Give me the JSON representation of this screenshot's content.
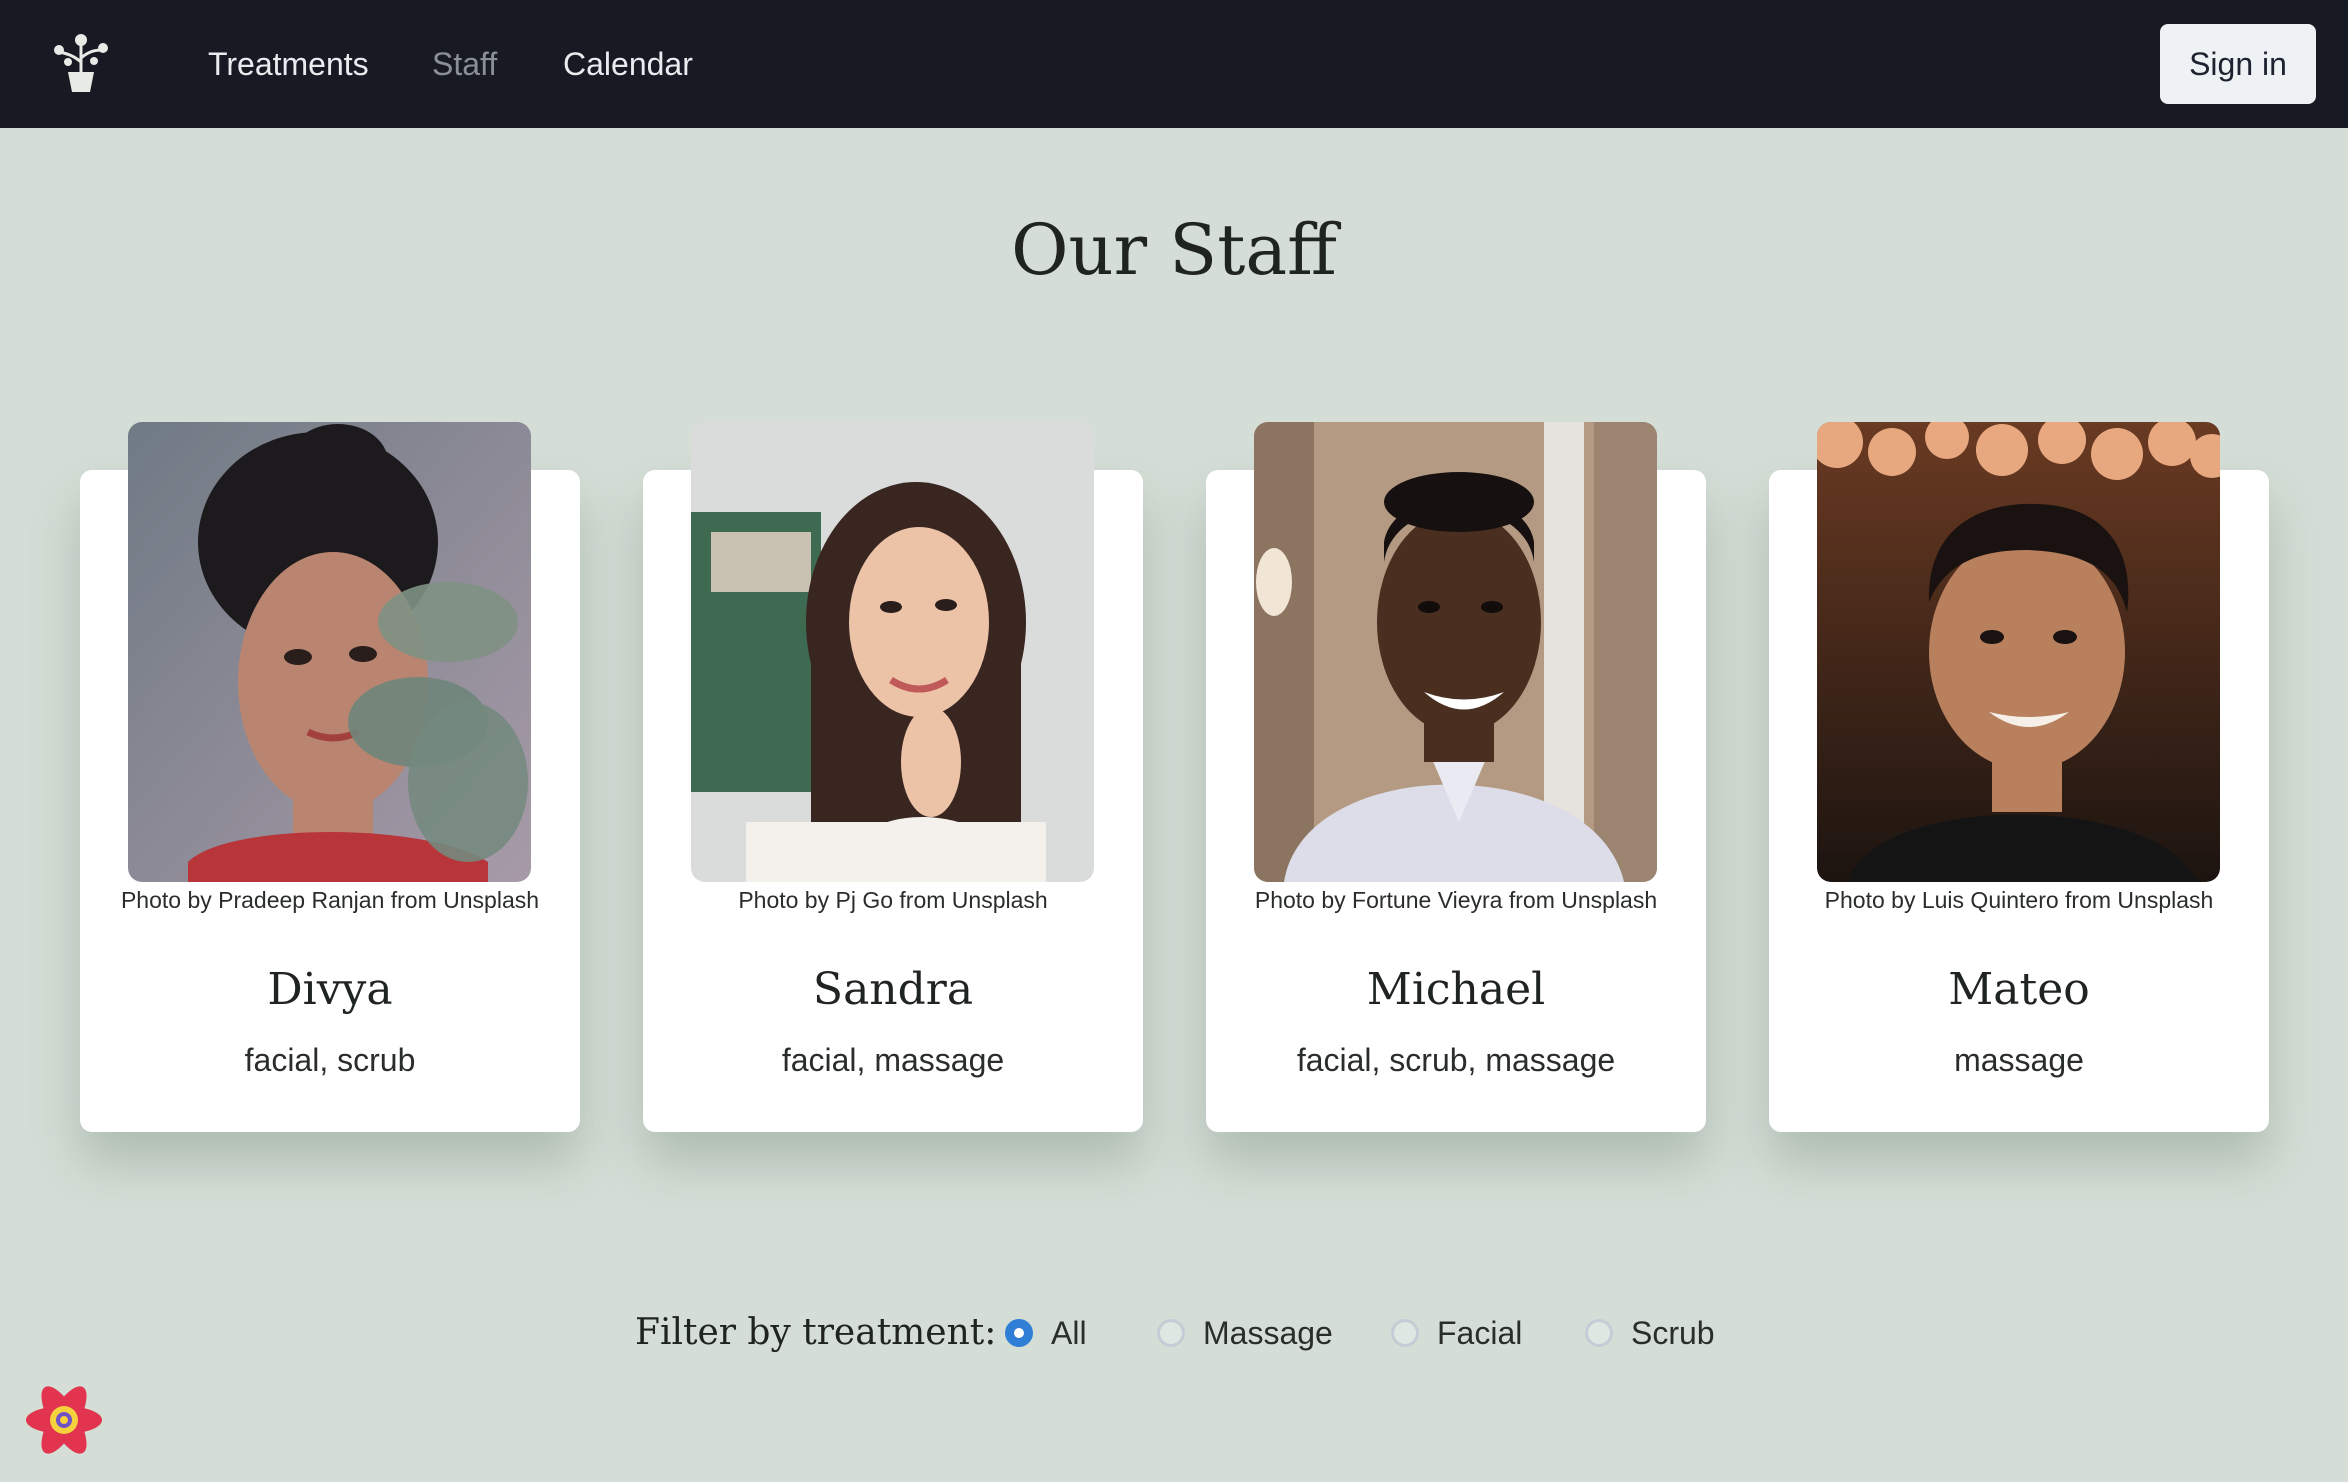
{
  "nav": {
    "links": [
      "Treatments",
      "Staff",
      "Calendar"
    ],
    "active": "Staff",
    "sign_in": "Sign in",
    "logo_icon": "potted-plant-icon"
  },
  "page": {
    "title": "Our Staff"
  },
  "staff": [
    {
      "name": "Divya",
      "treatments": "facial, scrub",
      "credit": "Photo by Pradeep Ranjan from Unsplash"
    },
    {
      "name": "Sandra",
      "treatments": "facial, massage",
      "credit": "Photo by Pj Go from Unsplash"
    },
    {
      "name": "Michael",
      "treatments": "facial, scrub, massage",
      "credit": "Photo by Fortune Vieyra from Unsplash"
    },
    {
      "name": "Mateo",
      "treatments": "massage",
      "credit": "Photo by Luis Quintero from Unsplash"
    }
  ],
  "filter": {
    "label": "Filter by treatment:",
    "options": [
      "All",
      "Massage",
      "Facial",
      "Scrub"
    ],
    "selected": "All"
  },
  "colors": {
    "background": "#d4ded6",
    "topbar": "#171a23",
    "radio_accent": "#2f7fd6"
  },
  "devtools_icon": "react-query-devtools-icon"
}
